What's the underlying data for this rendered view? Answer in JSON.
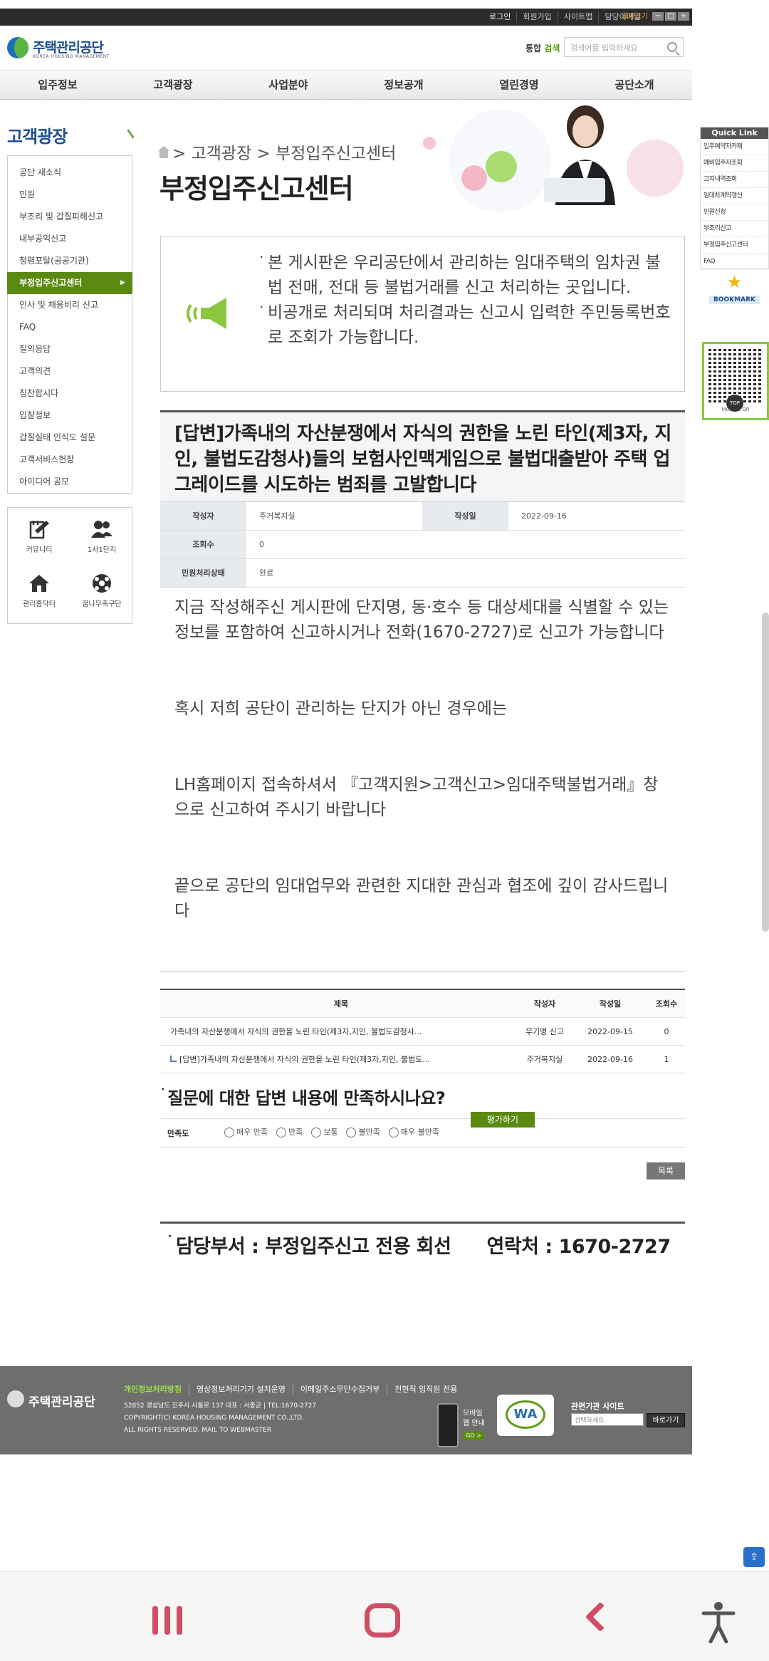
{
  "topbar": {
    "links": [
      "로그인",
      "회원가입",
      "사이트맵",
      "담당이메일"
    ],
    "font_label": "글씨크기",
    "font_controls": [
      "−",
      "□",
      "+"
    ]
  },
  "header": {
    "logo_text": "주택관리공단",
    "logo_sub": "KOREA HOUSING MANAGEMENT",
    "search_label_1": "통합",
    "search_label_2": "검색",
    "search_placeholder": "검색어를 입력하세요"
  },
  "gnb": [
    "입주정보",
    "고객광장",
    "사업분야",
    "정보공개",
    "열린경영",
    "공단소개"
  ],
  "lnb": {
    "title": "고객광장",
    "items": [
      {
        "label": "공단 새소식",
        "active": false
      },
      {
        "label": "민원",
        "active": false
      },
      {
        "label": "부조리 및 갑질피해신고",
        "active": false
      },
      {
        "label": "내부공익신고",
        "active": false
      },
      {
        "label": "청렴포탈(공공기관)",
        "active": false
      },
      {
        "label": "부정입주신고센터",
        "active": true
      },
      {
        "label": "인사 및 채용비리 신고",
        "active": false
      },
      {
        "label": "FAQ",
        "active": false
      },
      {
        "label": "질의응답",
        "active": false
      },
      {
        "label": "고객의견",
        "active": false
      },
      {
        "label": "칭찬합시다",
        "active": false
      },
      {
        "label": "입찰정보",
        "active": false
      },
      {
        "label": "갑질실태 인식도 설문",
        "active": false
      },
      {
        "label": "고객서비스헌장",
        "active": false
      },
      {
        "label": "아이디어 공모",
        "active": false
      }
    ],
    "quick": [
      {
        "label": "커뮤니티",
        "icon": "community-icon"
      },
      {
        "label": "1사1단지",
        "icon": "people-icon"
      },
      {
        "label": "관리홈닥터",
        "icon": "home-icon"
      },
      {
        "label": "꿈나무축구단",
        "icon": "soccer-ball-icon"
      }
    ]
  },
  "banner": {
    "breadcrumb": "> 고객광장 > 부정입주신고센터",
    "title": "부정입주신고센터"
  },
  "notice": {
    "line1": "본 게시판은 우리공단에서 관리하는 임대주택의 임차권 불법 전매, 전대 등 불법거래를 신고 처리하는 곳입니다.",
    "line2": "비공개로 처리되며 처리결과는 신고시 입력한 주민등록번호로 조회가 가능합니다."
  },
  "post": {
    "title": "[답변]가족내의 자산분쟁에서 자식의 권한을 노린 타인(제3자, 지인, 불법도감청사)들의 보험사인맥게임으로 불법대출받아 주택 업그레이드를 시도하는 범죄를 고발합니다",
    "meta": {
      "writer_label": "작성자",
      "writer": "주거복지실",
      "date_label": "작성일",
      "date": "2022-09-16",
      "views_label": "조회수",
      "views": "0",
      "status_label": "민원처리상태",
      "status": "완료"
    },
    "body": [
      "지금 작성해주신 게시판에 단지명, 동·호수 등 대상세대를 식별할 수 있는 정보를 포함하여 신고하시거나 전화(1670-2727)로 신고가 가능합니다",
      "혹시 저희 공단이 관리하는 단지가 아닌 경우에는",
      "LH홈페이지 접속하셔서 『고객지원>고객신고>임대주택불법거래』창으로 신고하여 주시기 바랍니다",
      "끝으로 공단의 임대업무와 관련한 지대한 관심과 협조에 깊이 감사드립니다"
    ]
  },
  "list": {
    "headers": {
      "title": "제목",
      "writer": "작성자",
      "date": "작성일",
      "views": "조회수"
    },
    "rows": [
      {
        "title": "가족내의 자산분쟁에서 자식의 권한을 노린 타인(제3자,지인, 불법도감청사...",
        "writer": "무기명 신고",
        "date": "2022-09-15",
        "views": "0"
      },
      {
        "title": "[답변]가족내의 자산분쟁에서 자식의 권한을 노린 타인(제3자,지인, 불법도...",
        "writer": "주거복지실",
        "date": "2022-09-16",
        "views": "1"
      }
    ]
  },
  "survey": {
    "question": "질문에 대한 답변 내용에 만족하시나요?",
    "rate_button": "평가하기",
    "label": "만족도",
    "options": [
      "매우 만족",
      "만족",
      "보통",
      "불만족",
      "매우 불만족"
    ]
  },
  "list_button": "목록",
  "dept": {
    "dept_text": "담당부서 : 부정입주신고 전용 회선",
    "contact_text": "연락처 : 1670-2727"
  },
  "footer": {
    "logo_text": "주택관리공단",
    "links": [
      "개인정보처리방침",
      "영상정보처리기기 설치운영",
      "이메일주소무단수집거부",
      "전현직 임직원 전용"
    ],
    "address": "52852 경상남도 진주시 사들로 137 대표 : 서종균 | TEL:1670-2727",
    "copyright": "COPYRIGHT(C) KOREA HOUSING MANAGEMENT CO.,LTD.",
    "rights": "ALL RIGHTS RESERVED. MAIL TO WEBMASTER",
    "mobile_1": "모바일",
    "mobile_2": "웹 안내",
    "go_label": "GO >",
    "wa_label": "WA",
    "related_label": "관련기관 사이트",
    "select_placeholder": "선택하세요.",
    "go_button": "바로가기"
  },
  "right_quick": {
    "title": "Quick Link",
    "items": [
      "입주예약자카페",
      "예비입주자조회",
      "고지내역조회",
      "임대차계약갱신",
      "민원신청",
      "부조리신고",
      "부정입주신고센터",
      "FAQ"
    ],
    "bookmark": "BOOKMARK",
    "qr_label": "MOBILE QR",
    "top_label": "TOP"
  },
  "colors": {
    "brand_blue": "#1d4f8c",
    "active_green": "#5b8a13",
    "nav_pink": "#cf4e63"
  }
}
